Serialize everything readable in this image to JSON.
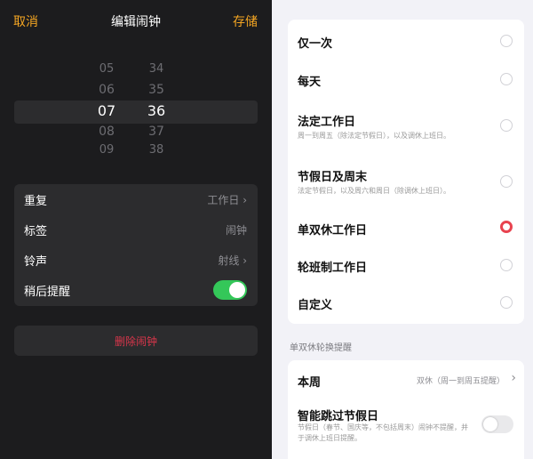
{
  "left": {
    "header": {
      "cancel": "取消",
      "title": "编辑闹钟",
      "save": "存储"
    },
    "picker": {
      "hours": [
        "05",
        "06",
        "07",
        "08",
        "09"
      ],
      "minutes": [
        "34",
        "35",
        "36",
        "37",
        "38"
      ],
      "selected_hour": "07",
      "selected_minute": "36"
    },
    "settings": [
      {
        "label": "重复",
        "value": "工作日",
        "chevron": "›"
      },
      {
        "label": "标签",
        "value": "闹钟"
      },
      {
        "label": "铃声",
        "value": "射线",
        "chevron": "›"
      },
      {
        "label": "稍后提醒",
        "toggle": true
      }
    ],
    "delete_label": "删除闹钟"
  },
  "right": {
    "options": [
      {
        "title": "仅一次",
        "desc": "",
        "selected": false
      },
      {
        "title": "每天",
        "desc": "",
        "selected": false
      },
      {
        "title": "法定工作日",
        "desc": "周一到周五（除法定节假日），以及调休上班日。",
        "selected": false
      },
      {
        "title": "节假日及周末",
        "desc": "法定节假日，以及周六和周日（除调休上班日）。",
        "selected": false
      },
      {
        "title": "单双休工作日",
        "desc": "",
        "selected": true
      },
      {
        "title": "轮班制工作日",
        "desc": "",
        "selected": false
      },
      {
        "title": "自定义",
        "desc": "",
        "selected": false
      }
    ],
    "section_label": "单双休轮换提醒",
    "week": {
      "title": "本周",
      "value": "双休（周一到周五提醒）",
      "chevron": "›"
    },
    "skip": {
      "title": "智能跳过节假日",
      "desc": "节假日（春节、国庆等，不包括周末）闹钟不提醒，并于调休上班日提醒。",
      "on": false
    },
    "accent": "#e8434f"
  }
}
